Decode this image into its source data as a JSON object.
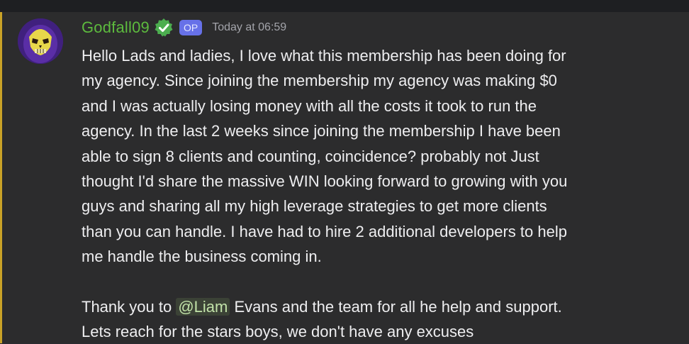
{
  "message": {
    "author": {
      "username": "Godfall09",
      "badge": "OP",
      "timestamp": "Today at 06:59",
      "avatar_icon": "skull-avatar-icon",
      "verified_icon": "verified-check-icon",
      "username_color": "#5dbb3e"
    },
    "body": {
      "line1": "Hello Lads and ladies, I love what this membership has been doing for",
      "line2": "my agency. Since joining the membership my agency was making $0",
      "line3": "and I was actually losing money with all the costs it took to run the",
      "line4": "agency. In the last 2 weeks since joining the membership I have been",
      "line5": "able to sign 8 clients and counting, coincidence? probably not  Just",
      "line6": "thought I'd share the massive WIN  looking forward to growing with you",
      "line7": "guys and sharing all my high leverage strategies to get more clients",
      "line8": "than you can handle. I have had to hire 2 additional developers to help",
      "line9": "me handle the business coming in.",
      "thanks_prefix": "Thank you to ",
      "mention": "@Liam",
      "thanks_suffix": " Evans and the team for all he help and support.",
      "closing": "Lets reach for the stars boys, we don't have any excuses"
    },
    "colors": {
      "highlight_bar": "#c9a227",
      "mention_text": "#c2e3a9",
      "op_badge": "#6771e8"
    }
  }
}
